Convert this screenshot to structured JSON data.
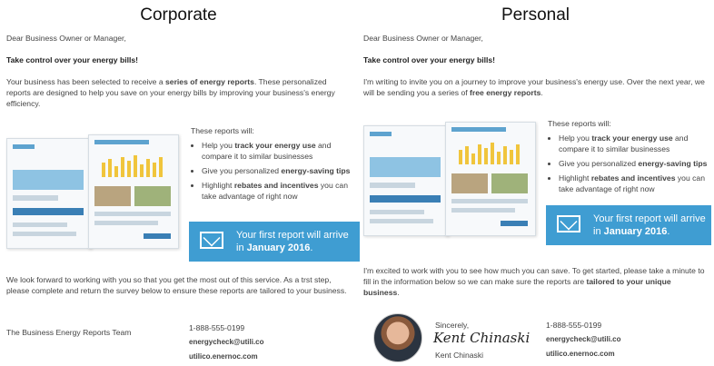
{
  "left": {
    "heading": "Corporate",
    "greeting": "Dear Business Owner or Manager,",
    "headline": "Take control over your energy bills!",
    "intro_a": "Your business has been selected to receive a ",
    "intro_b": "series of energy reports",
    "intro_c": ". These personalized reports are designed to help you save on your energy bills by improving your business's energy efficiency.",
    "reports_title": "These reports will:",
    "bullets": [
      {
        "a": "Help you ",
        "b": "track your energy use",
        "c": " and compare it to similar businesses"
      },
      {
        "a": "Give you personalized ",
        "b": "energy-saving tips",
        "c": ""
      },
      {
        "a": "Highlight ",
        "b": "rebates and incentives",
        "c": " you can take advantage of right now"
      }
    ],
    "banner_line1": "Your first report will arrive",
    "banner_in": "in ",
    "banner_date": "January 2016",
    "banner_end": ".",
    "closing": "We look forward to working with you so that you get the most out of this service. As a trst step, please complete and return the survey below to ensure these reports are tailored to your business.",
    "signoff": "The Business Energy Reports Team",
    "phone": "1-888-555-0199",
    "email": "energycheck@utili.co",
    "site": "utilico.enernoc.com"
  },
  "right": {
    "heading": "Personal",
    "greeting": "Dear Business Owner or Manager,",
    "headline": "Take control over your energy bills!",
    "intro_a": "I'm writing to invite you on a journey to improve your business's energy use. Over the next year, we will be sending you a series of ",
    "intro_b": "free energy reports",
    "intro_c": ".",
    "reports_title": "These reports will:",
    "bullets": [
      {
        "a": "Help you ",
        "b": "track your energy use",
        "c": " and compare it to similar businesses"
      },
      {
        "a": "Give you personalized ",
        "b": "energy-saving tips",
        "c": ""
      },
      {
        "a": "Highlight ",
        "b": "rebates and incentives",
        "c": " you can take advantage of right now"
      }
    ],
    "banner_line1": "Your first report will arrive",
    "banner_in": "in ",
    "banner_date": "January 2016",
    "banner_end": ".",
    "closing_a": "I'm excited to work with you to see how much you can save. To get started, please take a minute to fill in the information below so we can make sure the reports are ",
    "closing_b": "tailored to your unique business",
    "closing_c": ".",
    "sincerely": "Sincerely,",
    "signature": "Kent Chinaski",
    "name": "Kent Chinaski",
    "phone": "1-888-555-0199",
    "email": "energycheck@utili.co",
    "site": "utilico.enernoc.com"
  },
  "colors": {
    "banner": "#3f9dd2",
    "text": "#444444"
  }
}
